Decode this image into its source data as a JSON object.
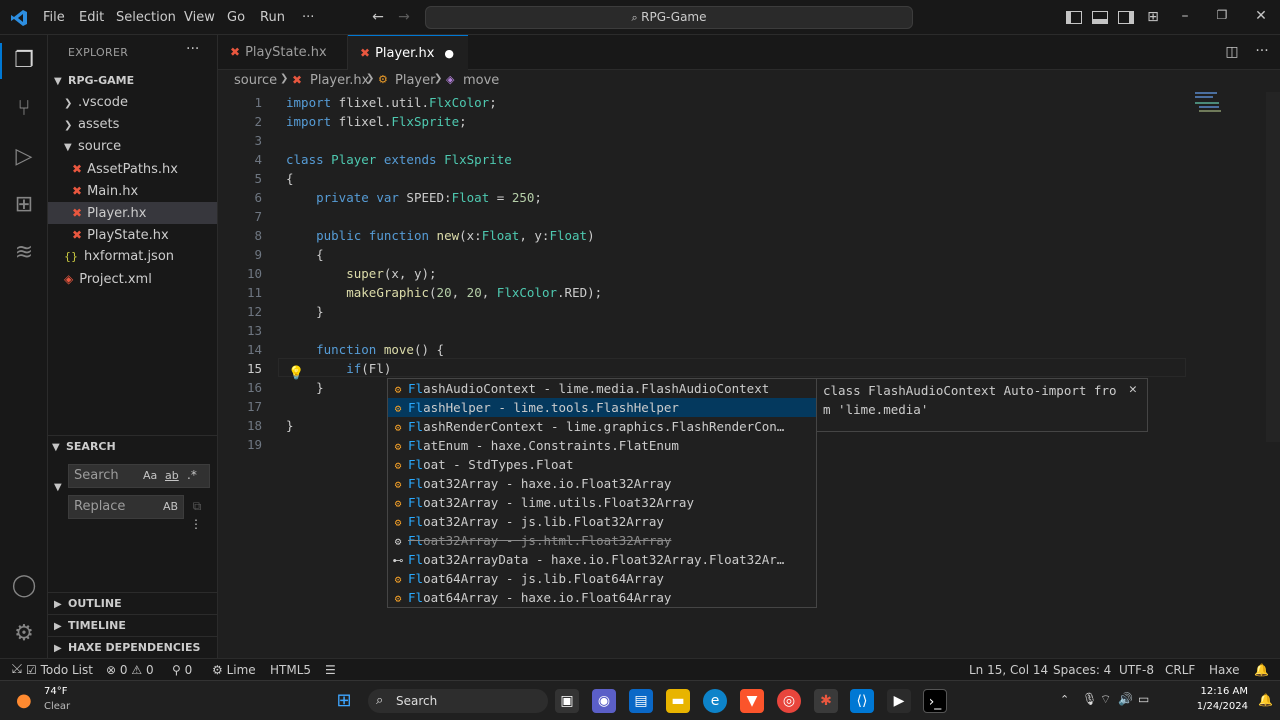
{
  "titlebar": {
    "menus": [
      "File",
      "Edit",
      "Selection",
      "View",
      "Go",
      "Run",
      "···"
    ],
    "command_center": "RPG-Game"
  },
  "sidebar": {
    "explorer_title": "EXPLORER",
    "project": "RPG-GAME",
    "items": [
      {
        "label": ".vscode"
      },
      {
        "label": "assets"
      },
      {
        "label": "source"
      },
      {
        "label": "AssetPaths.hx"
      },
      {
        "label": "Main.hx"
      },
      {
        "label": "Player.hx"
      },
      {
        "label": "PlayState.hx"
      },
      {
        "label": "hxformat.json"
      },
      {
        "label": "Project.xml"
      }
    ],
    "search": {
      "title": "SEARCH",
      "search_placeholder": "Search",
      "replace_placeholder": "Replace",
      "case_label": "Aa",
      "word_label": "ab",
      "regex_label": ".*",
      "preserve_case_label": "AB"
    },
    "sections": [
      "OUTLINE",
      "TIMELINE",
      "HAXE DEPENDENCIES"
    ]
  },
  "tabs": [
    {
      "label": "PlayState.hx",
      "active": false
    },
    {
      "label": "Player.hx",
      "active": true
    }
  ],
  "breadcrumbs": [
    "source",
    "Player.hx",
    "Player",
    "move"
  ],
  "editor": {
    "lines": [
      {
        "n": "1",
        "text": "import flixel.util.FlxColor;"
      },
      {
        "n": "2",
        "text": "import flixel.FlxSprite;"
      },
      {
        "n": "3",
        "text": ""
      },
      {
        "n": "4",
        "text": "class Player extends FlxSprite"
      },
      {
        "n": "5",
        "text": "{"
      },
      {
        "n": "6",
        "text": "    private var SPEED:Float = 250;"
      },
      {
        "n": "7",
        "text": ""
      },
      {
        "n": "8",
        "text": "    public function new(x:Float, y:Float)"
      },
      {
        "n": "9",
        "text": "    {"
      },
      {
        "n": "10",
        "text": "        super(x, y);"
      },
      {
        "n": "11",
        "text": "        makeGraphic(20, 20, FlxColor.RED);"
      },
      {
        "n": "12",
        "text": "    }"
      },
      {
        "n": "13",
        "text": ""
      },
      {
        "n": "14",
        "text": "    function move() {"
      },
      {
        "n": "15",
        "text": "        if(Fl)"
      },
      {
        "n": "16",
        "text": "    }"
      },
      {
        "n": "17",
        "text": ""
      },
      {
        "n": "18",
        "text": "}"
      },
      {
        "n": "19",
        "text": ""
      }
    ]
  },
  "suggestions": [
    {
      "label": "FlashAudioContext - lime.media.FlashAudioContext",
      "deprecated": false
    },
    {
      "label": "FlashHelper - lime.tools.FlashHelper",
      "deprecated": false
    },
    {
      "label": "FlashRenderContext - lime.graphics.FlashRenderCon…",
      "deprecated": false
    },
    {
      "label": "FlatEnum - haxe.Constraints.FlatEnum",
      "deprecated": false
    },
    {
      "label": "Float - StdTypes.Float",
      "deprecated": false
    },
    {
      "label": "Float32Array - haxe.io.Float32Array",
      "deprecated": false
    },
    {
      "label": "Float32Array - lime.utils.Float32Array",
      "deprecated": false
    },
    {
      "label": "Float32Array - js.lib.Float32Array",
      "deprecated": false
    },
    {
      "label": "Float32Array - js.html.Float32Array",
      "deprecated": true
    },
    {
      "label": "Float32ArrayData - haxe.io.Float32Array.Float32Ar…",
      "deprecated": false
    },
    {
      "label": "Float64Array - js.lib.Float64Array",
      "deprecated": false
    },
    {
      "label": "Float64Array - haxe.io.Float64Array",
      "deprecated": false
    }
  ],
  "suggestion_detail": {
    "line1": "class FlashAudioContext Auto-import fro",
    "line2": "m 'lime.media'"
  },
  "statusbar": {
    "todo": "Todo List",
    "errors": "0",
    "warnings": "0",
    "ports": "0",
    "lime": "Lime",
    "target": "HTML5",
    "position": "Ln 15, Col 14",
    "spaces": "Spaces: 4",
    "encoding": "UTF-8",
    "eol": "CRLF",
    "language": "Haxe"
  },
  "taskbar": {
    "weather_temp": "74°F",
    "weather_desc": "Clear",
    "search_label": "Search",
    "time": "12:16 AM",
    "date": "1/24/2024"
  },
  "colors": {
    "accent": "#0078d4",
    "haxe_file": "#e9573f",
    "keyword": "#569cd6",
    "type": "#4ec9b0",
    "function": "#dcdcaa",
    "number": "#b5cea8",
    "match": "#2aaaff"
  }
}
